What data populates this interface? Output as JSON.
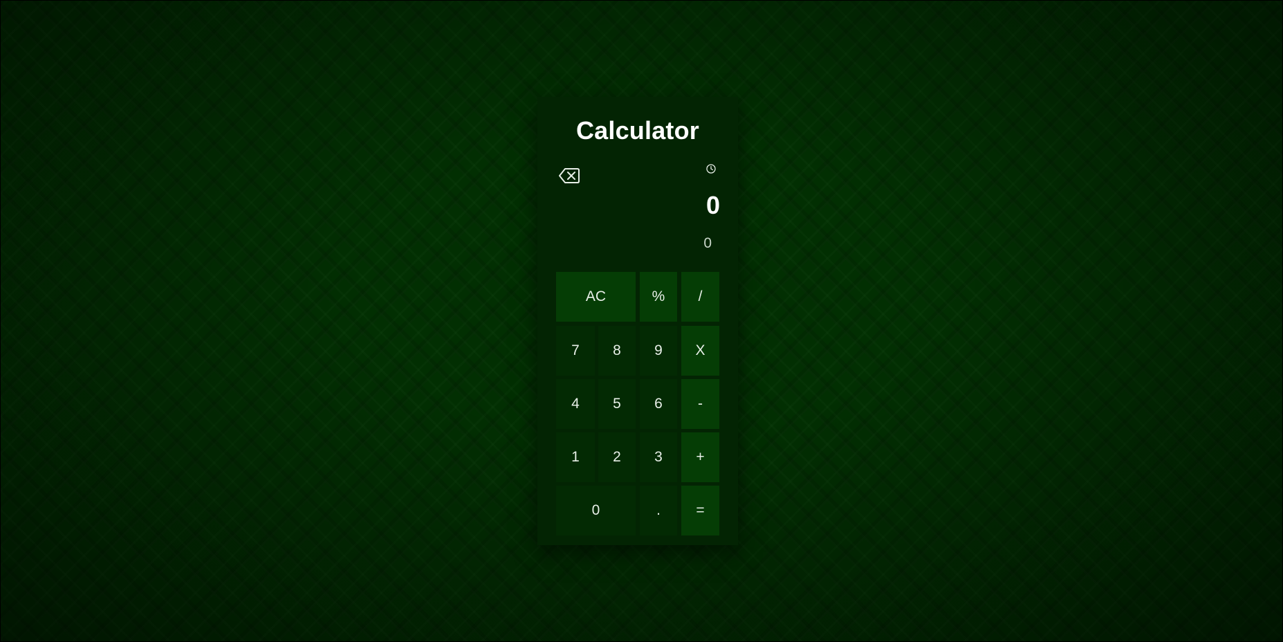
{
  "app": {
    "title": "Calculator"
  },
  "display": {
    "value": "0",
    "secondary": "0"
  },
  "icons": {
    "backspace": "backspace-icon",
    "history": "history-icon"
  },
  "keys": {
    "ac": "AC",
    "percent": "%",
    "divide": "/",
    "seven": "7",
    "eight": "8",
    "nine": "9",
    "multiply": "X",
    "four": "4",
    "five": "5",
    "six": "6",
    "minus": "-",
    "one": "1",
    "two": "2",
    "three": "3",
    "plus": "+",
    "zero": "0",
    "decimal": ".",
    "equals": "="
  },
  "colors": {
    "background": "#022f02",
    "panel": "#032403",
    "operator_key": "#053d05",
    "number_key": "#032a03",
    "text": "#ffffff"
  }
}
